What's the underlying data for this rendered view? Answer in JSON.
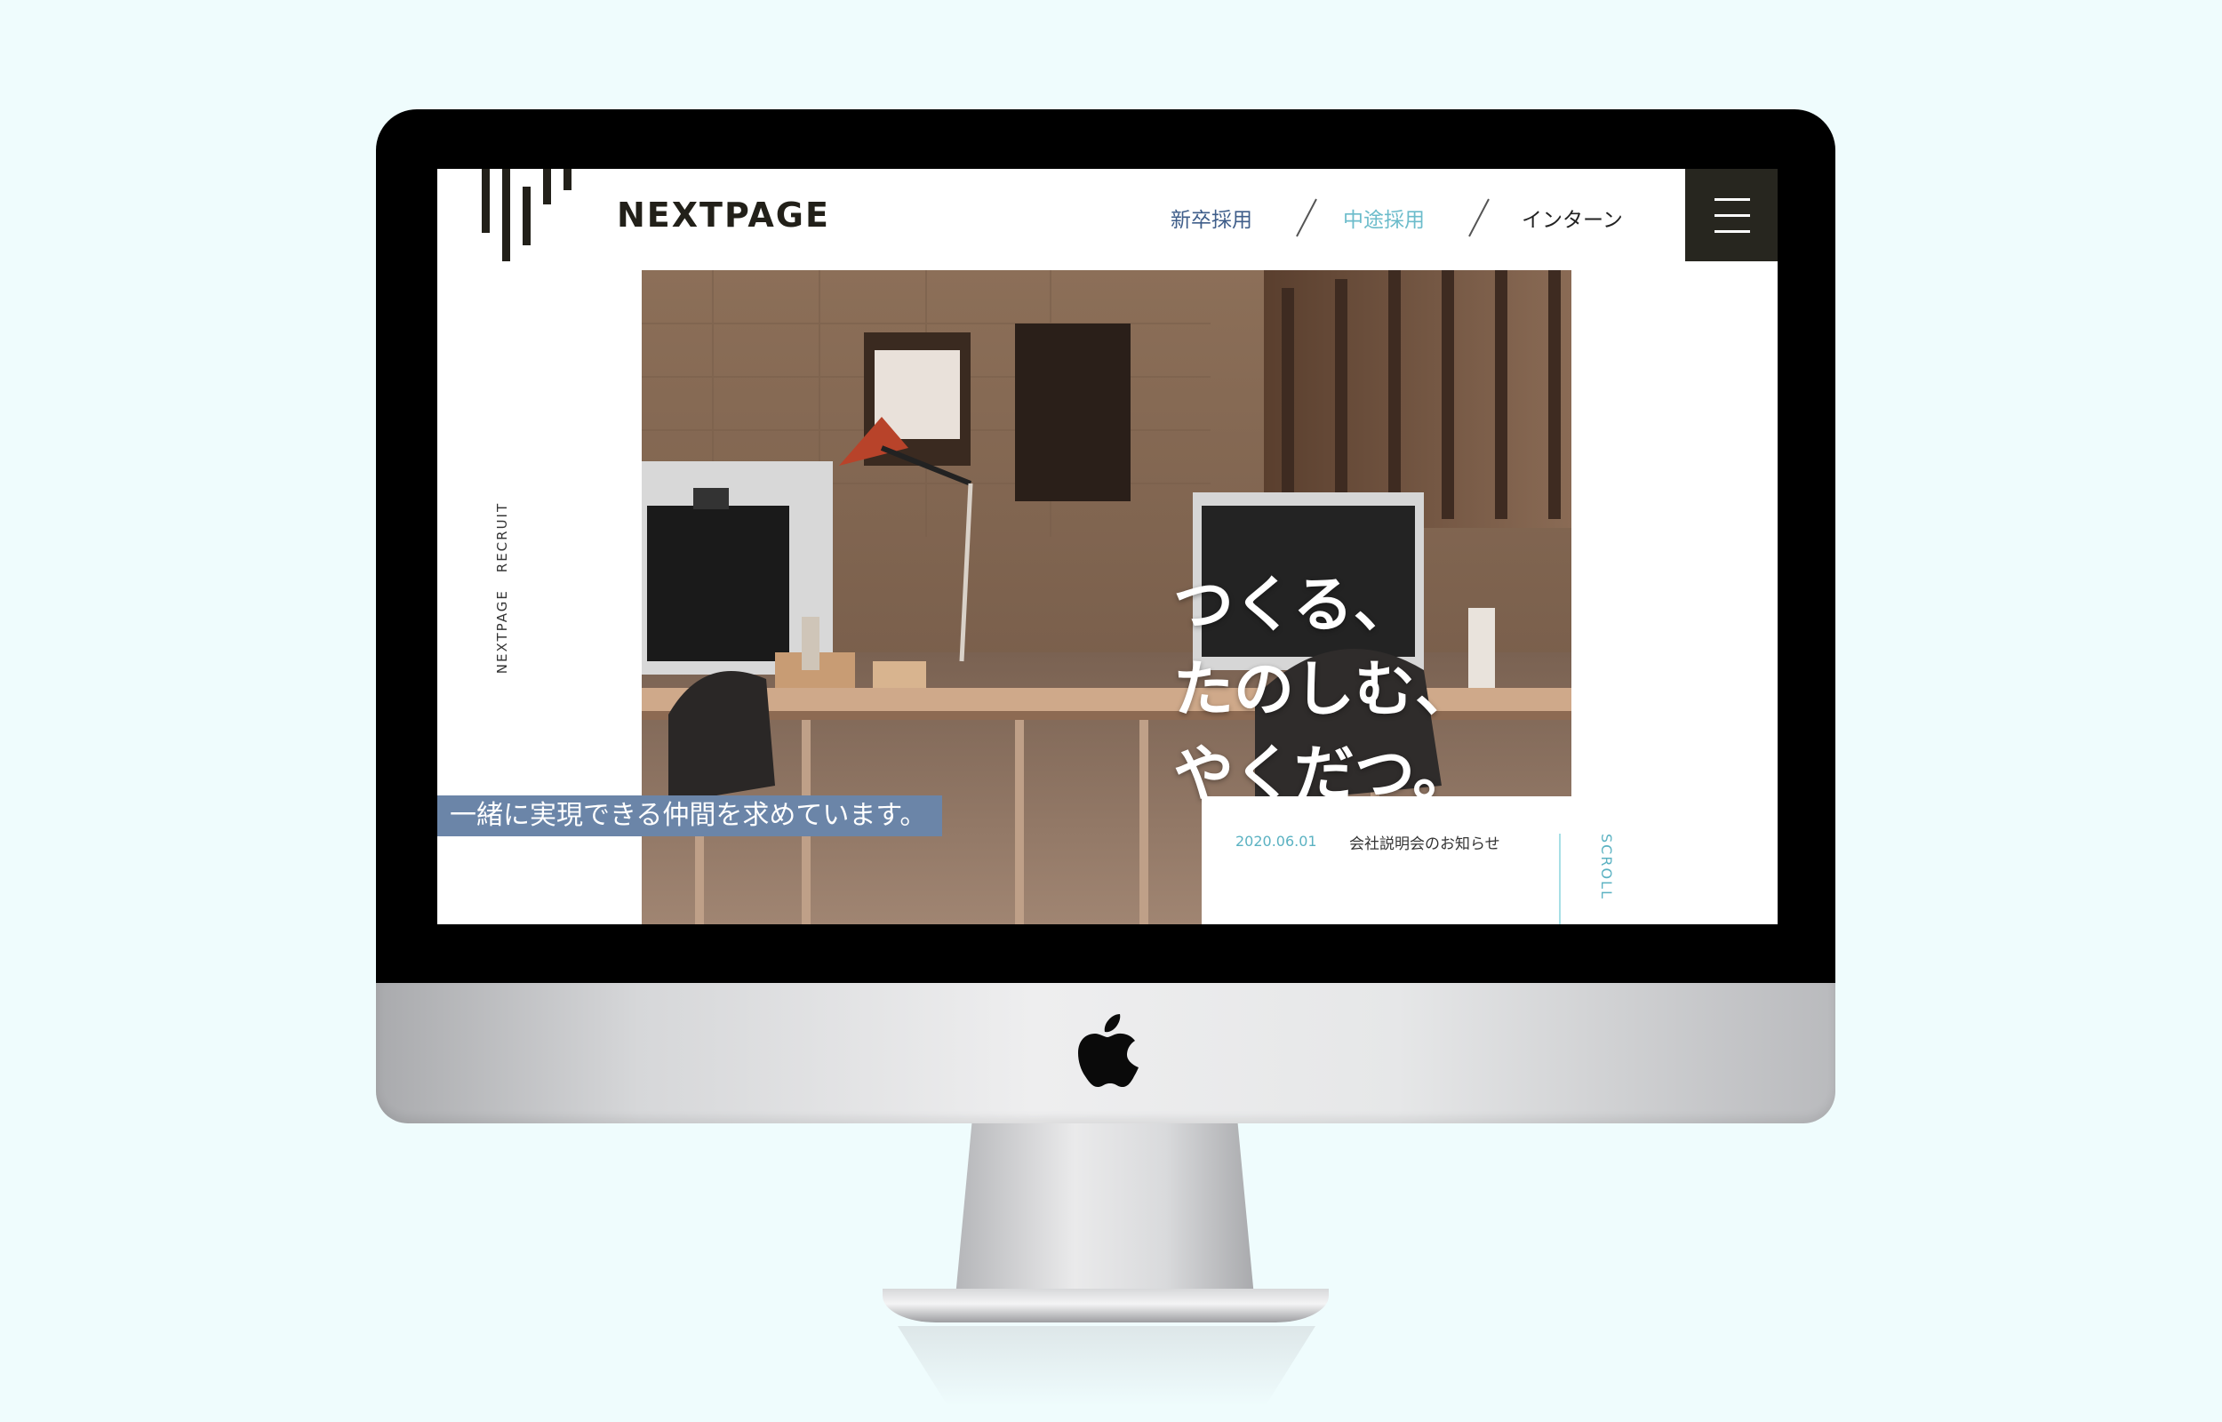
{
  "logo": {
    "text": "NEXTPAGE"
  },
  "nav": {
    "items": [
      {
        "label": "新卒採用",
        "color": "#3f5e8a"
      },
      {
        "label": "中途採用",
        "color": "#6cbccb"
      },
      {
        "label": "インターン",
        "color": "#222222"
      }
    ]
  },
  "side_label": {
    "brand": "NEXTPAGE",
    "section": "RECRUIT"
  },
  "hero": {
    "catch_lines": [
      "つくる、",
      "たのしむ、",
      "やくだつ。"
    ],
    "tagline": "一緒に実現できる仲間を求めています。"
  },
  "news": {
    "date": "2020.06.01",
    "title": "会社説明会のお知らせ"
  },
  "scroll": {
    "label": "SCROLL"
  },
  "colors": {
    "page_background": "#effcfd",
    "accent_blue": "#6b85a8",
    "accent_teal": "#5bb2c2",
    "menu_button": "#27261f",
    "logo_dark": "#222019"
  },
  "icons": [
    "apple-logo",
    "hamburger-menu-icon",
    "nextpage-logo-mark"
  ]
}
